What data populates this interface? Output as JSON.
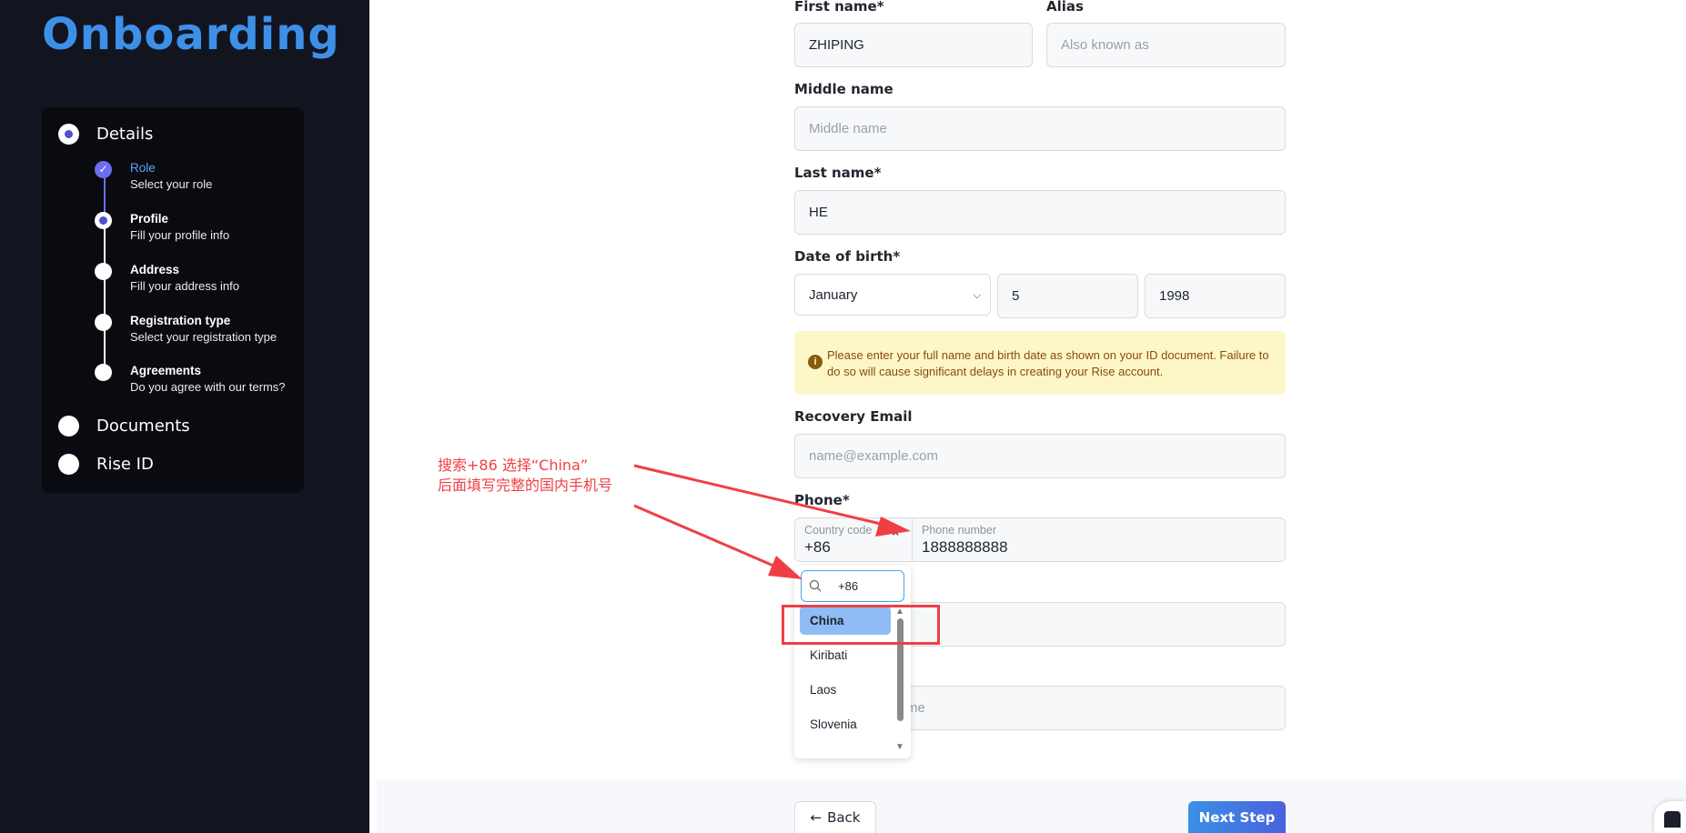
{
  "sidebar": {
    "brand": "Onboarding",
    "steps": [
      {
        "label": "Details",
        "state": "active"
      },
      {
        "label": "Documents",
        "state": "pending"
      },
      {
        "label": "Rise ID",
        "state": "pending"
      }
    ],
    "substeps": [
      {
        "title": "Role",
        "desc": "Select your role",
        "state": "done"
      },
      {
        "title": "Profile",
        "desc": "Fill your profile info",
        "state": "current"
      },
      {
        "title": "Address",
        "desc": "Fill your address info",
        "state": "pending"
      },
      {
        "title": "Registration type",
        "desc": "Select your registration type",
        "state": "pending"
      },
      {
        "title": "Agreements",
        "desc": "Do you agree with our terms?",
        "state": "pending"
      }
    ]
  },
  "form": {
    "first_name": {
      "label": "First name*",
      "value": "ZHIPING"
    },
    "alias": {
      "label": "Alias",
      "placeholder": "Also known as"
    },
    "middle_name": {
      "label": "Middle name",
      "placeholder": "Middle name"
    },
    "last_name": {
      "label": "Last name*",
      "value": "HE"
    },
    "dob": {
      "label": "Date of birth*",
      "month": "January",
      "day": "5",
      "year": "1998"
    },
    "notice": "Please enter your full name and birth date as shown on your ID document. Failure to do so will cause significant delays in creating your Rise account.",
    "recovery_email": {
      "label": "Recovery Email",
      "placeholder": "name@example.com"
    },
    "phone": {
      "label": "Phone*",
      "country_code_label": "Country code",
      "country_code_value": "+86",
      "number_label": "Phone number",
      "number_value": "1888888888"
    },
    "hidden_field_tail": "me"
  },
  "dropdown": {
    "search_value": "+86",
    "options": [
      "China",
      "Kiribati",
      "Laos",
      "Slovenia"
    ],
    "selected": "China"
  },
  "annotation": {
    "line1": "搜索+86 选择“China”",
    "line2": "后面填写完整的国内手机号",
    "color": "#ef3f46"
  },
  "footer": {
    "back_label": "Back",
    "next_label": "Next Step"
  },
  "colors": {
    "sidebar_bg": "#121520",
    "brand": "#3d90e8",
    "accent": "#4e4fd1",
    "notice_bg": "#fdf7c8",
    "selected_option": "#8fbcf5"
  }
}
